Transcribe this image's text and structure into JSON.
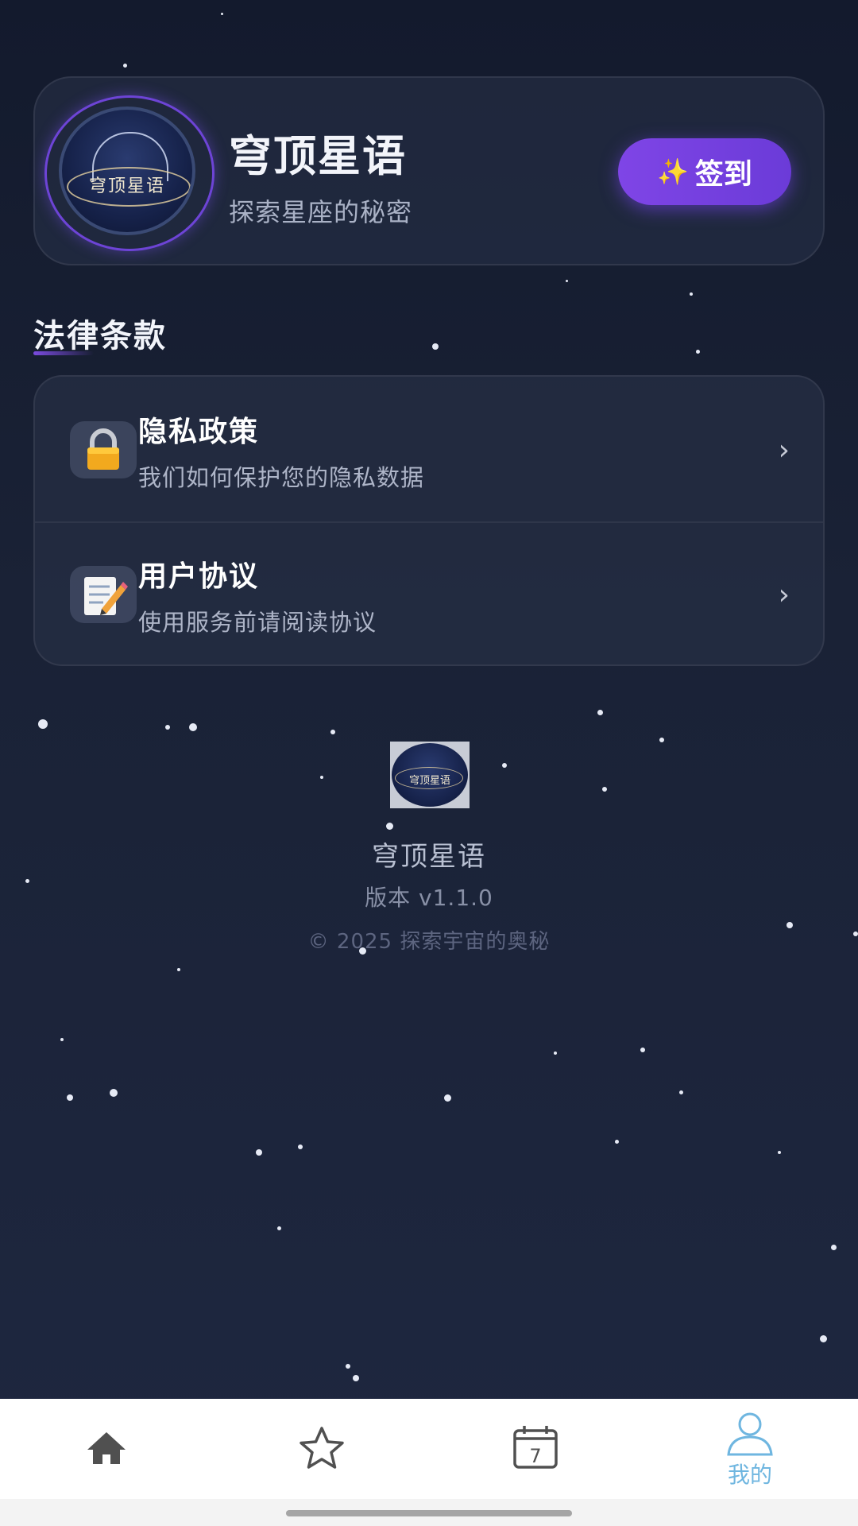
{
  "header": {
    "logo_text": "穹顶星语",
    "title": "穹顶星语",
    "subtitle": "探索星座的秘密",
    "checkin_icon": "sparkles-icon",
    "checkin_label": "签到"
  },
  "section": {
    "title": "法律条款"
  },
  "legal_items": [
    {
      "icon": "lock-icon",
      "title": "隐私政策",
      "description": "我们如何保护您的隐私数据"
    },
    {
      "icon": "memo-icon",
      "title": "用户协议",
      "description": "使用服务前请阅读协议"
    }
  ],
  "footer": {
    "logo_text": "穹顶星语",
    "app_name": "穹顶星语",
    "version": "版本 v1.1.0",
    "copyright": "© 2025 探索宇宙的奥秘"
  },
  "bottom_nav": [
    {
      "icon": "home-icon",
      "label": "",
      "active": false
    },
    {
      "icon": "star-icon",
      "label": "",
      "active": false
    },
    {
      "icon": "calendar-icon",
      "label": "",
      "active": false
    },
    {
      "icon": "user-icon",
      "label": "我的",
      "active": true
    }
  ],
  "colors": {
    "accent": "#7446e0",
    "active_nav": "#6fb6e0",
    "background": "#1a2236"
  }
}
